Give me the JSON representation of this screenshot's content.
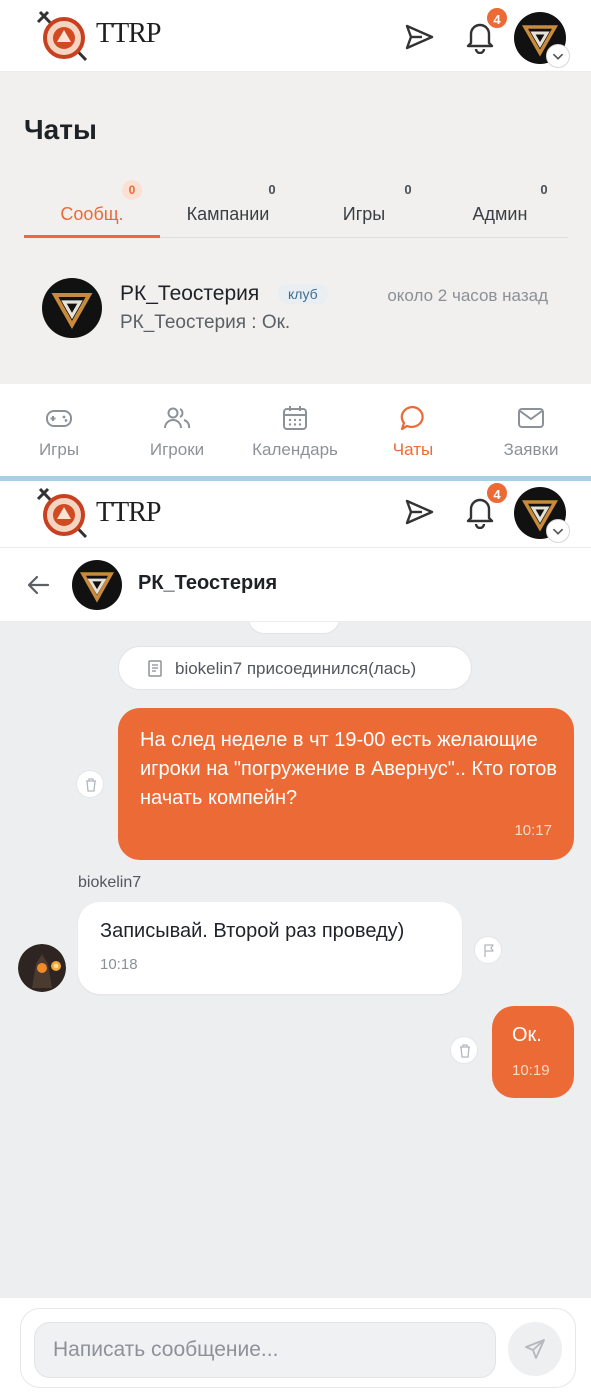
{
  "app": {
    "brand": "TTRP",
    "notifications_count": "4"
  },
  "chats_list": {
    "title": "Чаты",
    "tabs": [
      {
        "label": "Сообщ.",
        "count": "0",
        "active": true
      },
      {
        "label": "Кампании",
        "count": "0",
        "active": false
      },
      {
        "label": "Игры",
        "count": "0",
        "active": false
      },
      {
        "label": "Админ",
        "count": "0",
        "active": false
      }
    ],
    "items": [
      {
        "name": "РК_Теостерия",
        "tag": "клуб",
        "time": "около 2 часов назад",
        "last_message": "РК_Теостерия : Ок."
      }
    ]
  },
  "bottom_nav": [
    {
      "label": "Игры",
      "icon": "gamepad-icon",
      "active": false
    },
    {
      "label": "Игроки",
      "icon": "users-icon",
      "active": false
    },
    {
      "label": "Календарь",
      "icon": "calendar-icon",
      "active": false
    },
    {
      "label": "Чаты",
      "icon": "chat-bubble-icon",
      "active": true
    },
    {
      "label": "Заявки",
      "icon": "mail-icon",
      "active": false
    }
  ],
  "conversation": {
    "title": "РК_Теостерия",
    "system_message": "biokelin7 присоединился(лась)",
    "messages": [
      {
        "direction": "out",
        "text": "На след неделе в чт 19-00 есть желающие игроки на \"погружение в Авернус\".. Кто готов начать компейн?",
        "time": "10:17"
      },
      {
        "direction": "in",
        "sender": "biokelin7",
        "text": "Записывай. Второй раз проведу)",
        "time": "10:18"
      },
      {
        "direction": "out",
        "text": "Ок.",
        "time": "10:19"
      }
    ],
    "composer_placeholder": "Написать сообщение..."
  },
  "colors": {
    "accent": "#ec6a35",
    "background": "#f1f0ee",
    "chat_background": "#edeef0"
  }
}
